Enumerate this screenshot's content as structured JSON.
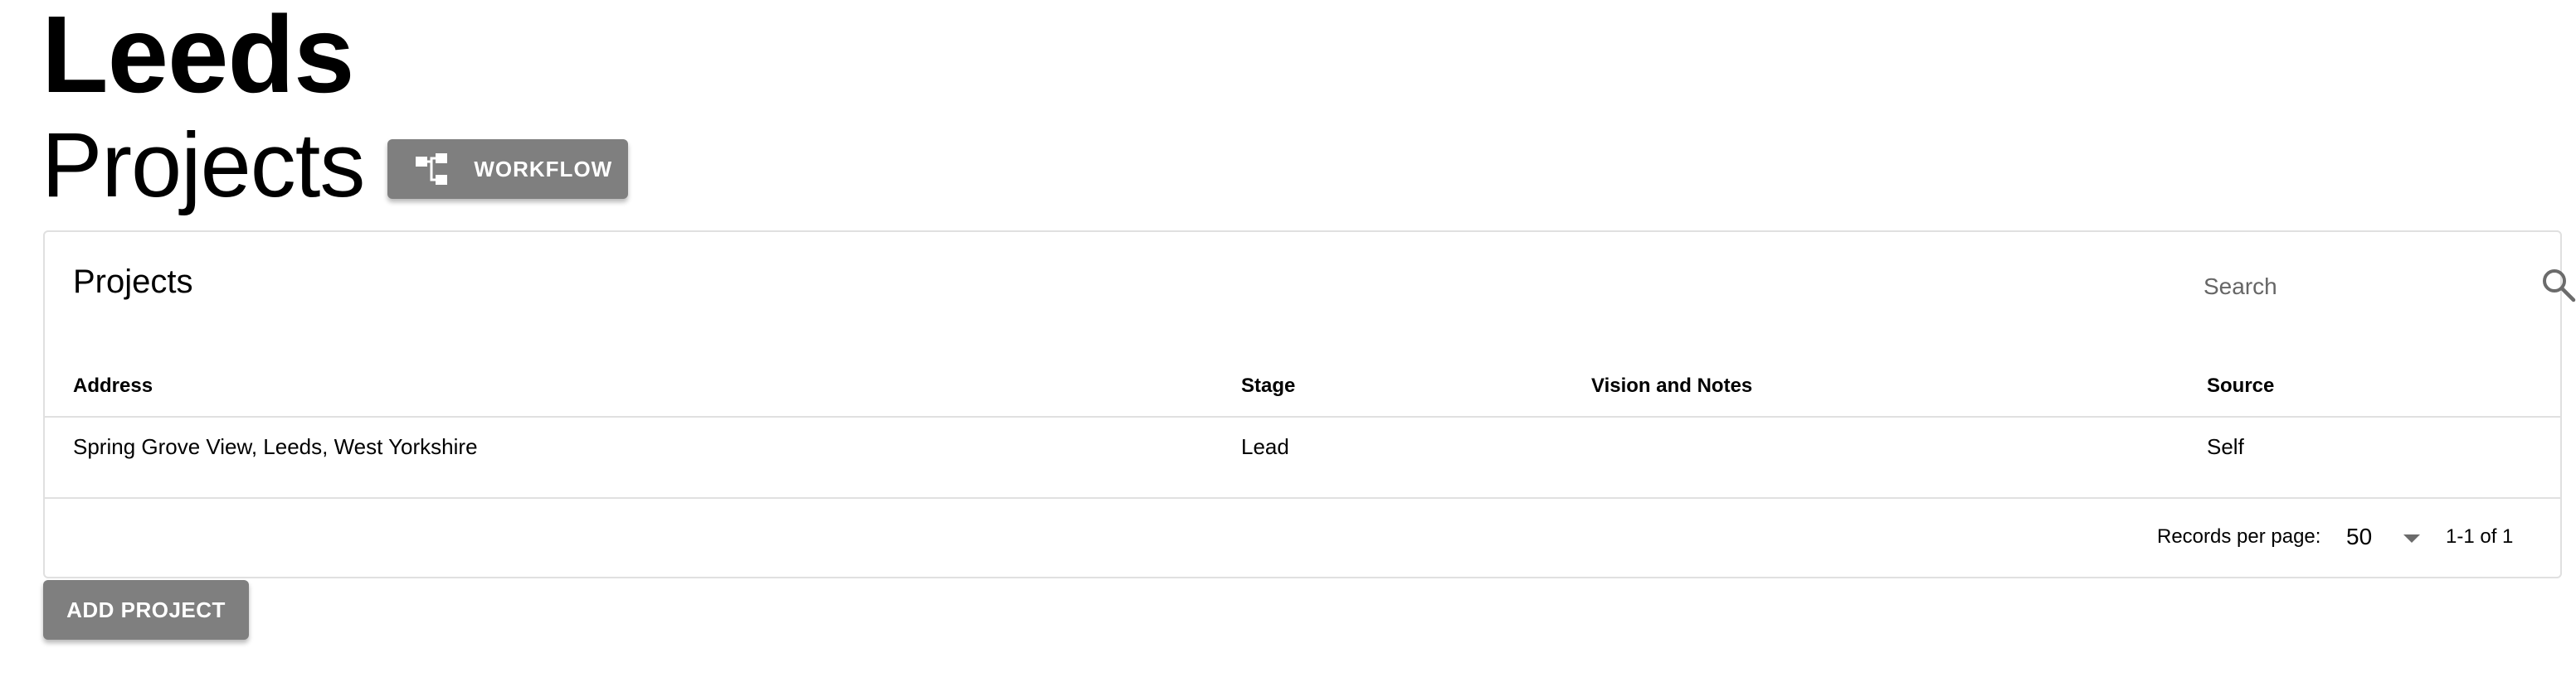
{
  "header": {
    "city": "Leeds",
    "section": "Projects",
    "workflow_button": {
      "label": "WORKFLOW",
      "icon": "workflow-tree-icon"
    }
  },
  "card": {
    "title": "Projects",
    "search": {
      "placeholder": "Search",
      "value": "",
      "icon": "search-icon"
    },
    "table": {
      "columns": [
        "Address",
        "Stage",
        "Vision and Notes",
        "Source"
      ],
      "rows": [
        {
          "address": "Spring Grove View, Leeds, West Yorkshire",
          "stage": "Lead",
          "vision_notes": "",
          "source": "Self"
        }
      ]
    },
    "pagination": {
      "records_per_page_label": "Records per page:",
      "records_per_page_value": "50",
      "range": "1-1 of 1"
    }
  },
  "add_project_button": {
    "label": "ADD PROJECT"
  },
  "colors": {
    "button_bg": "#7f7f7f",
    "button_text": "#ffffff",
    "border": "#e0e0e0"
  }
}
